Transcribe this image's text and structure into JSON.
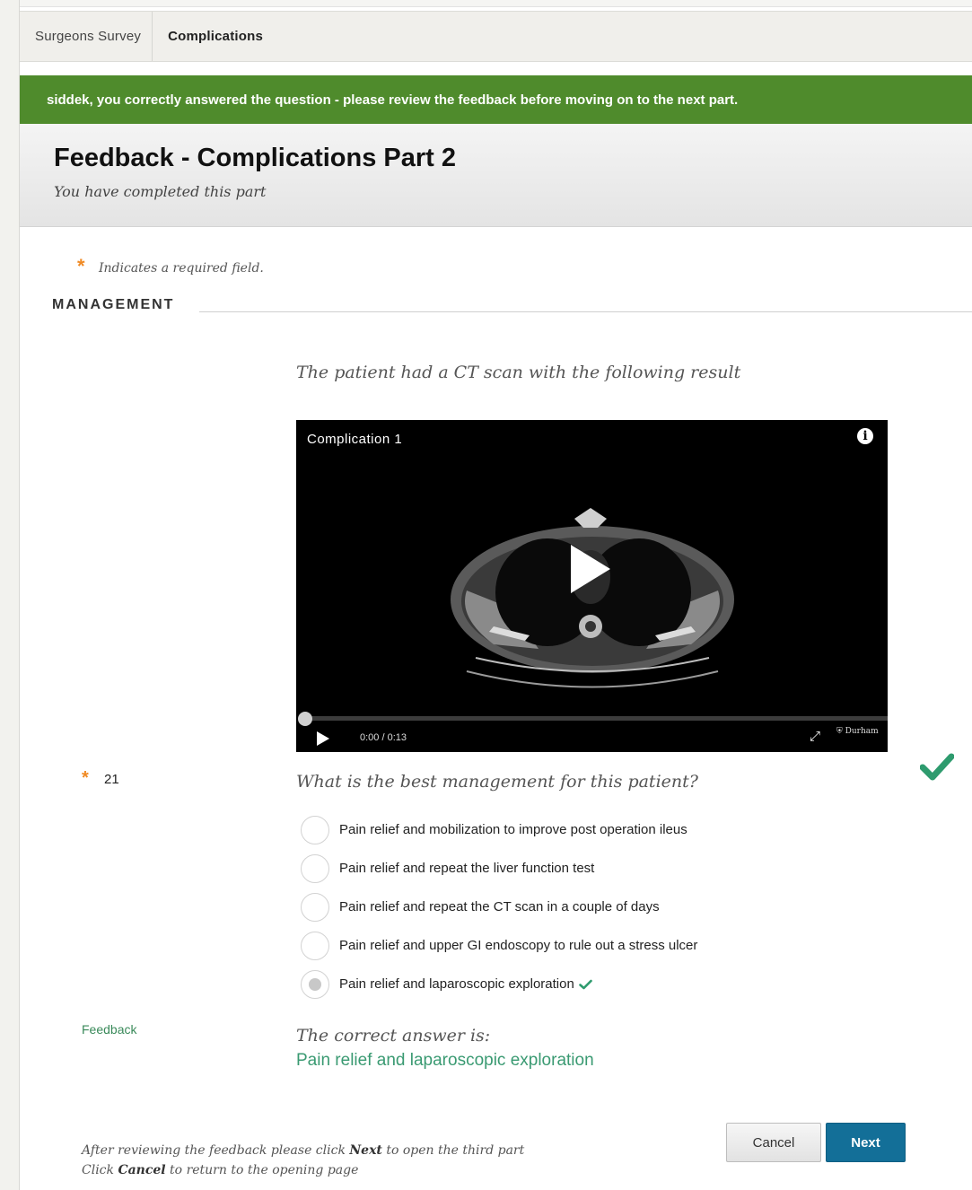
{
  "breadcrumbs": [
    "Surgeons Survey",
    "Complications"
  ],
  "banner": {
    "message": "siddek, you correctly answered the question - please review the feedback before moving on to the next part.",
    "color": "#4f8b2c"
  },
  "header": {
    "title": "Feedback - Complications Part 2",
    "subtitle": "You have completed this part"
  },
  "required": {
    "star": "*",
    "text": "Indicates a required field."
  },
  "section": {
    "title": "MANAGEMENT"
  },
  "content": {
    "intro": "The patient had a CT scan with the following result"
  },
  "video": {
    "title": "Complication 1",
    "info_icon": "info-icon",
    "time_current": "0:00",
    "time_total": "/ 0:13",
    "logo_text": "Durham",
    "progress": 0
  },
  "question": {
    "star": "*",
    "number": "21",
    "text": "What is the best management for this patient?",
    "options": [
      {
        "label": "Pain relief and mobilization to improve post operation ileus",
        "selected": false
      },
      {
        "label": "Pain relief and repeat the liver function test",
        "selected": false
      },
      {
        "label": "Pain relief and repeat the CT scan in a couple of days",
        "selected": false
      },
      {
        "label": "Pain relief and upper GI endoscopy to rule out a stress ulcer",
        "selected": false
      },
      {
        "label": "Pain relief and laparoscopic exploration",
        "selected": true
      }
    ],
    "result": "correct",
    "check_color": "#2e9b6e"
  },
  "feedback": {
    "label": "Feedback",
    "correct_intro": "The correct answer is:",
    "correct_answer": "Pain relief and laparoscopic exploration"
  },
  "footer": {
    "line1_pre": "After reviewing the feedback please click ",
    "line1_bold": "Next",
    "line1_post": " to open the third part",
    "line2_pre": "Click ",
    "line2_bold": "Cancel",
    "line2_post": " to return to the opening page"
  },
  "buttons": {
    "cancel": "Cancel",
    "next": "Next"
  }
}
